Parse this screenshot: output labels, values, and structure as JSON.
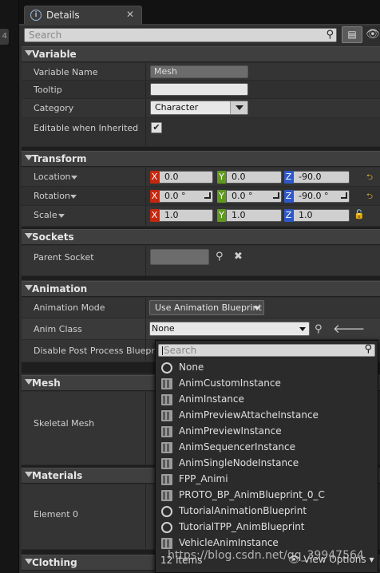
{
  "tab": {
    "title": "Details",
    "close": "✕"
  },
  "toolbar": {
    "search_placeholder": "Search"
  },
  "sections": {
    "variable": "Variable",
    "transform": "Transform",
    "sockets": "Sockets",
    "animation": "Animation",
    "mesh": "Mesh",
    "materials": "Materials",
    "clothing": "Clothing"
  },
  "variable": {
    "name_label": "Variable Name",
    "name_value": "Mesh",
    "tooltip_label": "Tooltip",
    "tooltip_value": "",
    "category_label": "Category",
    "category_value": "Character",
    "editable_label": "Editable when Inherited",
    "editable_checked": true
  },
  "transform": {
    "location_label": "Location",
    "rotation_label": "Rotation",
    "scale_label": "Scale",
    "axis_x": "X",
    "axis_y": "Y",
    "axis_z": "Z",
    "location": [
      "0.0",
      "0.0",
      "-90.0"
    ],
    "rotation": [
      "0.0 °",
      "0.0 °",
      "-90.0 °"
    ],
    "scale": [
      "1.0",
      "1.0",
      "1.0"
    ]
  },
  "sockets": {
    "parent_socket_label": "Parent Socket",
    "parent_socket_value": ""
  },
  "animation": {
    "mode_label": "Animation Mode",
    "mode_value": "Use Animation Blueprint",
    "anim_class_label": "Anim Class",
    "anim_class_value": "None",
    "disable_pp_label": "Disable Post Process Blueprint"
  },
  "mesh": {
    "skeletal_mesh_label": "Skeletal Mesh"
  },
  "materials": {
    "element0_label": "Element 0"
  },
  "popup": {
    "search_placeholder": "Search",
    "items": [
      {
        "label": "None",
        "icon": "circle-icon"
      },
      {
        "label": "AnimCustomInstance",
        "icon": "blueprint-icon"
      },
      {
        "label": "AnimInstance",
        "icon": "blueprint-icon"
      },
      {
        "label": "AnimPreviewAttacheInstance",
        "icon": "blueprint-icon"
      },
      {
        "label": "AnimPreviewInstance",
        "icon": "blueprint-icon"
      },
      {
        "label": "AnimSequencerInstance",
        "icon": "blueprint-icon"
      },
      {
        "label": "AnimSingleNodeInstance",
        "icon": "blueprint-icon"
      },
      {
        "label": "FPP_Animi",
        "icon": "blueprint-icon"
      },
      {
        "label": "PROTO_BP_AnimBlueprint_0_C",
        "icon": "blueprint-icon"
      },
      {
        "label": "TutorialAnimationBlueprint",
        "icon": "circle-icon"
      },
      {
        "label": "TutorialTPP_AnimBlueprint",
        "icon": "circle-icon"
      },
      {
        "label": "VehicleAnimInstance",
        "icon": "blueprint-icon"
      }
    ],
    "count": "12 items",
    "view_options": "View Options"
  },
  "watermark": "https://blog.csdn.net/qq_39947564"
}
